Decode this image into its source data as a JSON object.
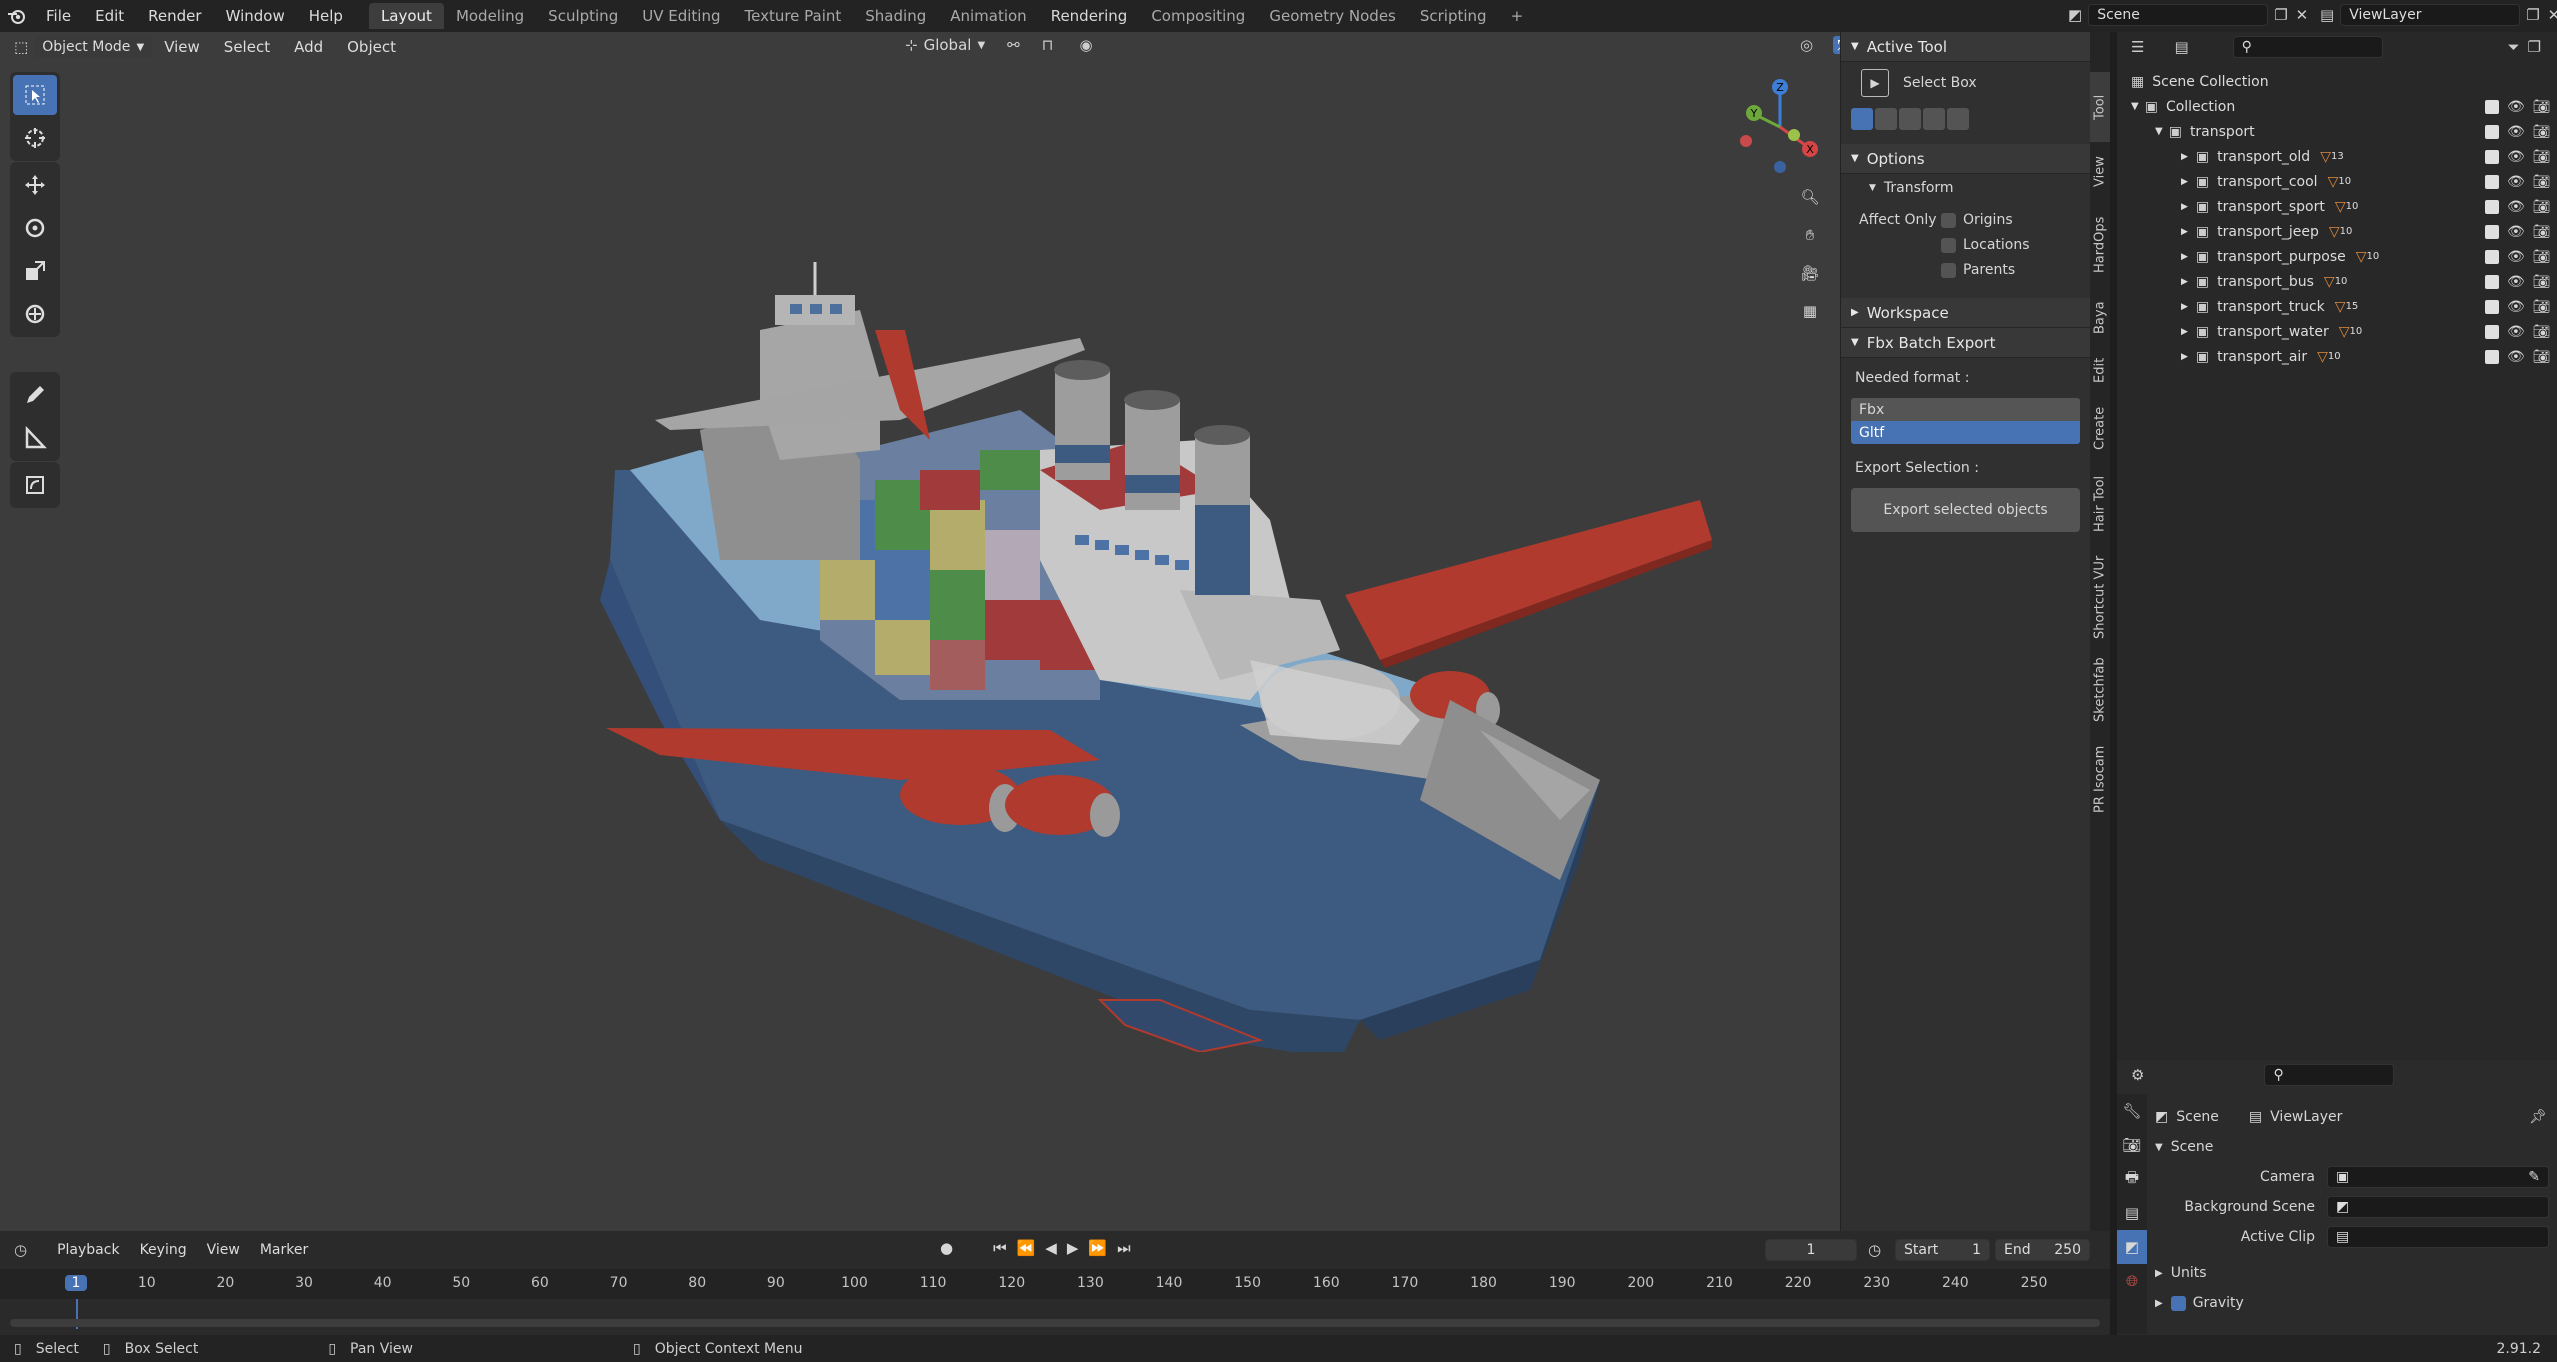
{
  "topbar": {
    "menus": [
      "File",
      "Edit",
      "Render",
      "Window",
      "Help"
    ],
    "workspaces": [
      "Layout",
      "Modeling",
      "Sculpting",
      "UV Editing",
      "Texture Paint",
      "Shading",
      "Animation",
      "Rendering",
      "Compositing",
      "Geometry Nodes",
      "Scripting"
    ],
    "active_workspace": "Layout",
    "add_tab": "+",
    "scene_name": "Scene",
    "view_layer": "ViewLayer"
  },
  "viewport": {
    "mode": "Object Mode",
    "menus": [
      "View",
      "Select",
      "Add",
      "Object"
    ],
    "orientation": "Global",
    "tools": [
      "select-box-tool",
      "cursor-tool",
      "move-tool",
      "rotate-tool",
      "scale-tool",
      "transform-tool",
      "annotate-tool",
      "measure-tool",
      "add-cube-tool"
    ],
    "gizmo": {
      "x": "X",
      "y": "Y",
      "z": "Z"
    }
  },
  "npanel": {
    "active_tool_title": "Active Tool",
    "active_tool_name": "Select Box",
    "options_title": "Options",
    "transform_title": "Transform",
    "affect_only": "Affect Only",
    "affect_options": [
      "Origins",
      "Locations",
      "Parents"
    ],
    "workspace_title": "Workspace",
    "fbx_title": "Fbx Batch Export",
    "needed_format": "Needed format :",
    "formats": [
      "Fbx",
      "Gltf"
    ],
    "selected_format": "Gltf",
    "export_selection": "Export Selection :",
    "export_button": "Export selected objects"
  },
  "vtabs": [
    "Tool",
    "View",
    "HardOps",
    "Baya",
    "Edit",
    "Create",
    "Hair Tool",
    "Shortcut VUr",
    "Sketchfab",
    "PR Isocam"
  ],
  "outliner": {
    "scene_collection": "Scene Collection",
    "collection": "Collection",
    "transport": "transport",
    "items": [
      {
        "name": "transport_old",
        "count": "13"
      },
      {
        "name": "transport_cool",
        "count": "10"
      },
      {
        "name": "transport_sport",
        "count": "10"
      },
      {
        "name": "transport_jeep",
        "count": "10"
      },
      {
        "name": "transport_purpose",
        "count": "10"
      },
      {
        "name": "transport_bus",
        "count": "10"
      },
      {
        "name": "transport_truck",
        "count": "15"
      },
      {
        "name": "transport_water",
        "count": "10"
      },
      {
        "name": "transport_air",
        "count": "10"
      }
    ]
  },
  "properties": {
    "breadcrumb_scene": "Scene",
    "breadcrumb_layer": "ViewLayer",
    "section": "Scene",
    "camera": "Camera",
    "background_scene": "Background Scene",
    "active_clip": "Active Clip",
    "units": "Units",
    "gravity": "Gravity"
  },
  "timeline": {
    "menus": [
      "Playback",
      "Keying",
      "View",
      "Marker"
    ],
    "current_frame": "1",
    "start_label": "Start",
    "start": "1",
    "end_label": "End",
    "end": "250",
    "ticks": [
      "1",
      "10",
      "20",
      "30",
      "40",
      "50",
      "60",
      "70",
      "80",
      "90",
      "100",
      "110",
      "120",
      "130",
      "140",
      "150",
      "160",
      "170",
      "180",
      "190",
      "200",
      "210",
      "220",
      "230",
      "240",
      "250"
    ]
  },
  "statusbar": {
    "select": "Select",
    "box_select": "Box Select",
    "pan_view": "Pan View",
    "context_menu": "Object Context Menu",
    "version": "2.91.2"
  },
  "colors": {
    "accent": "#4772b3",
    "hull": "#3d5a80",
    "wing": "#b03a2e",
    "grey": "#9a9a9a"
  }
}
